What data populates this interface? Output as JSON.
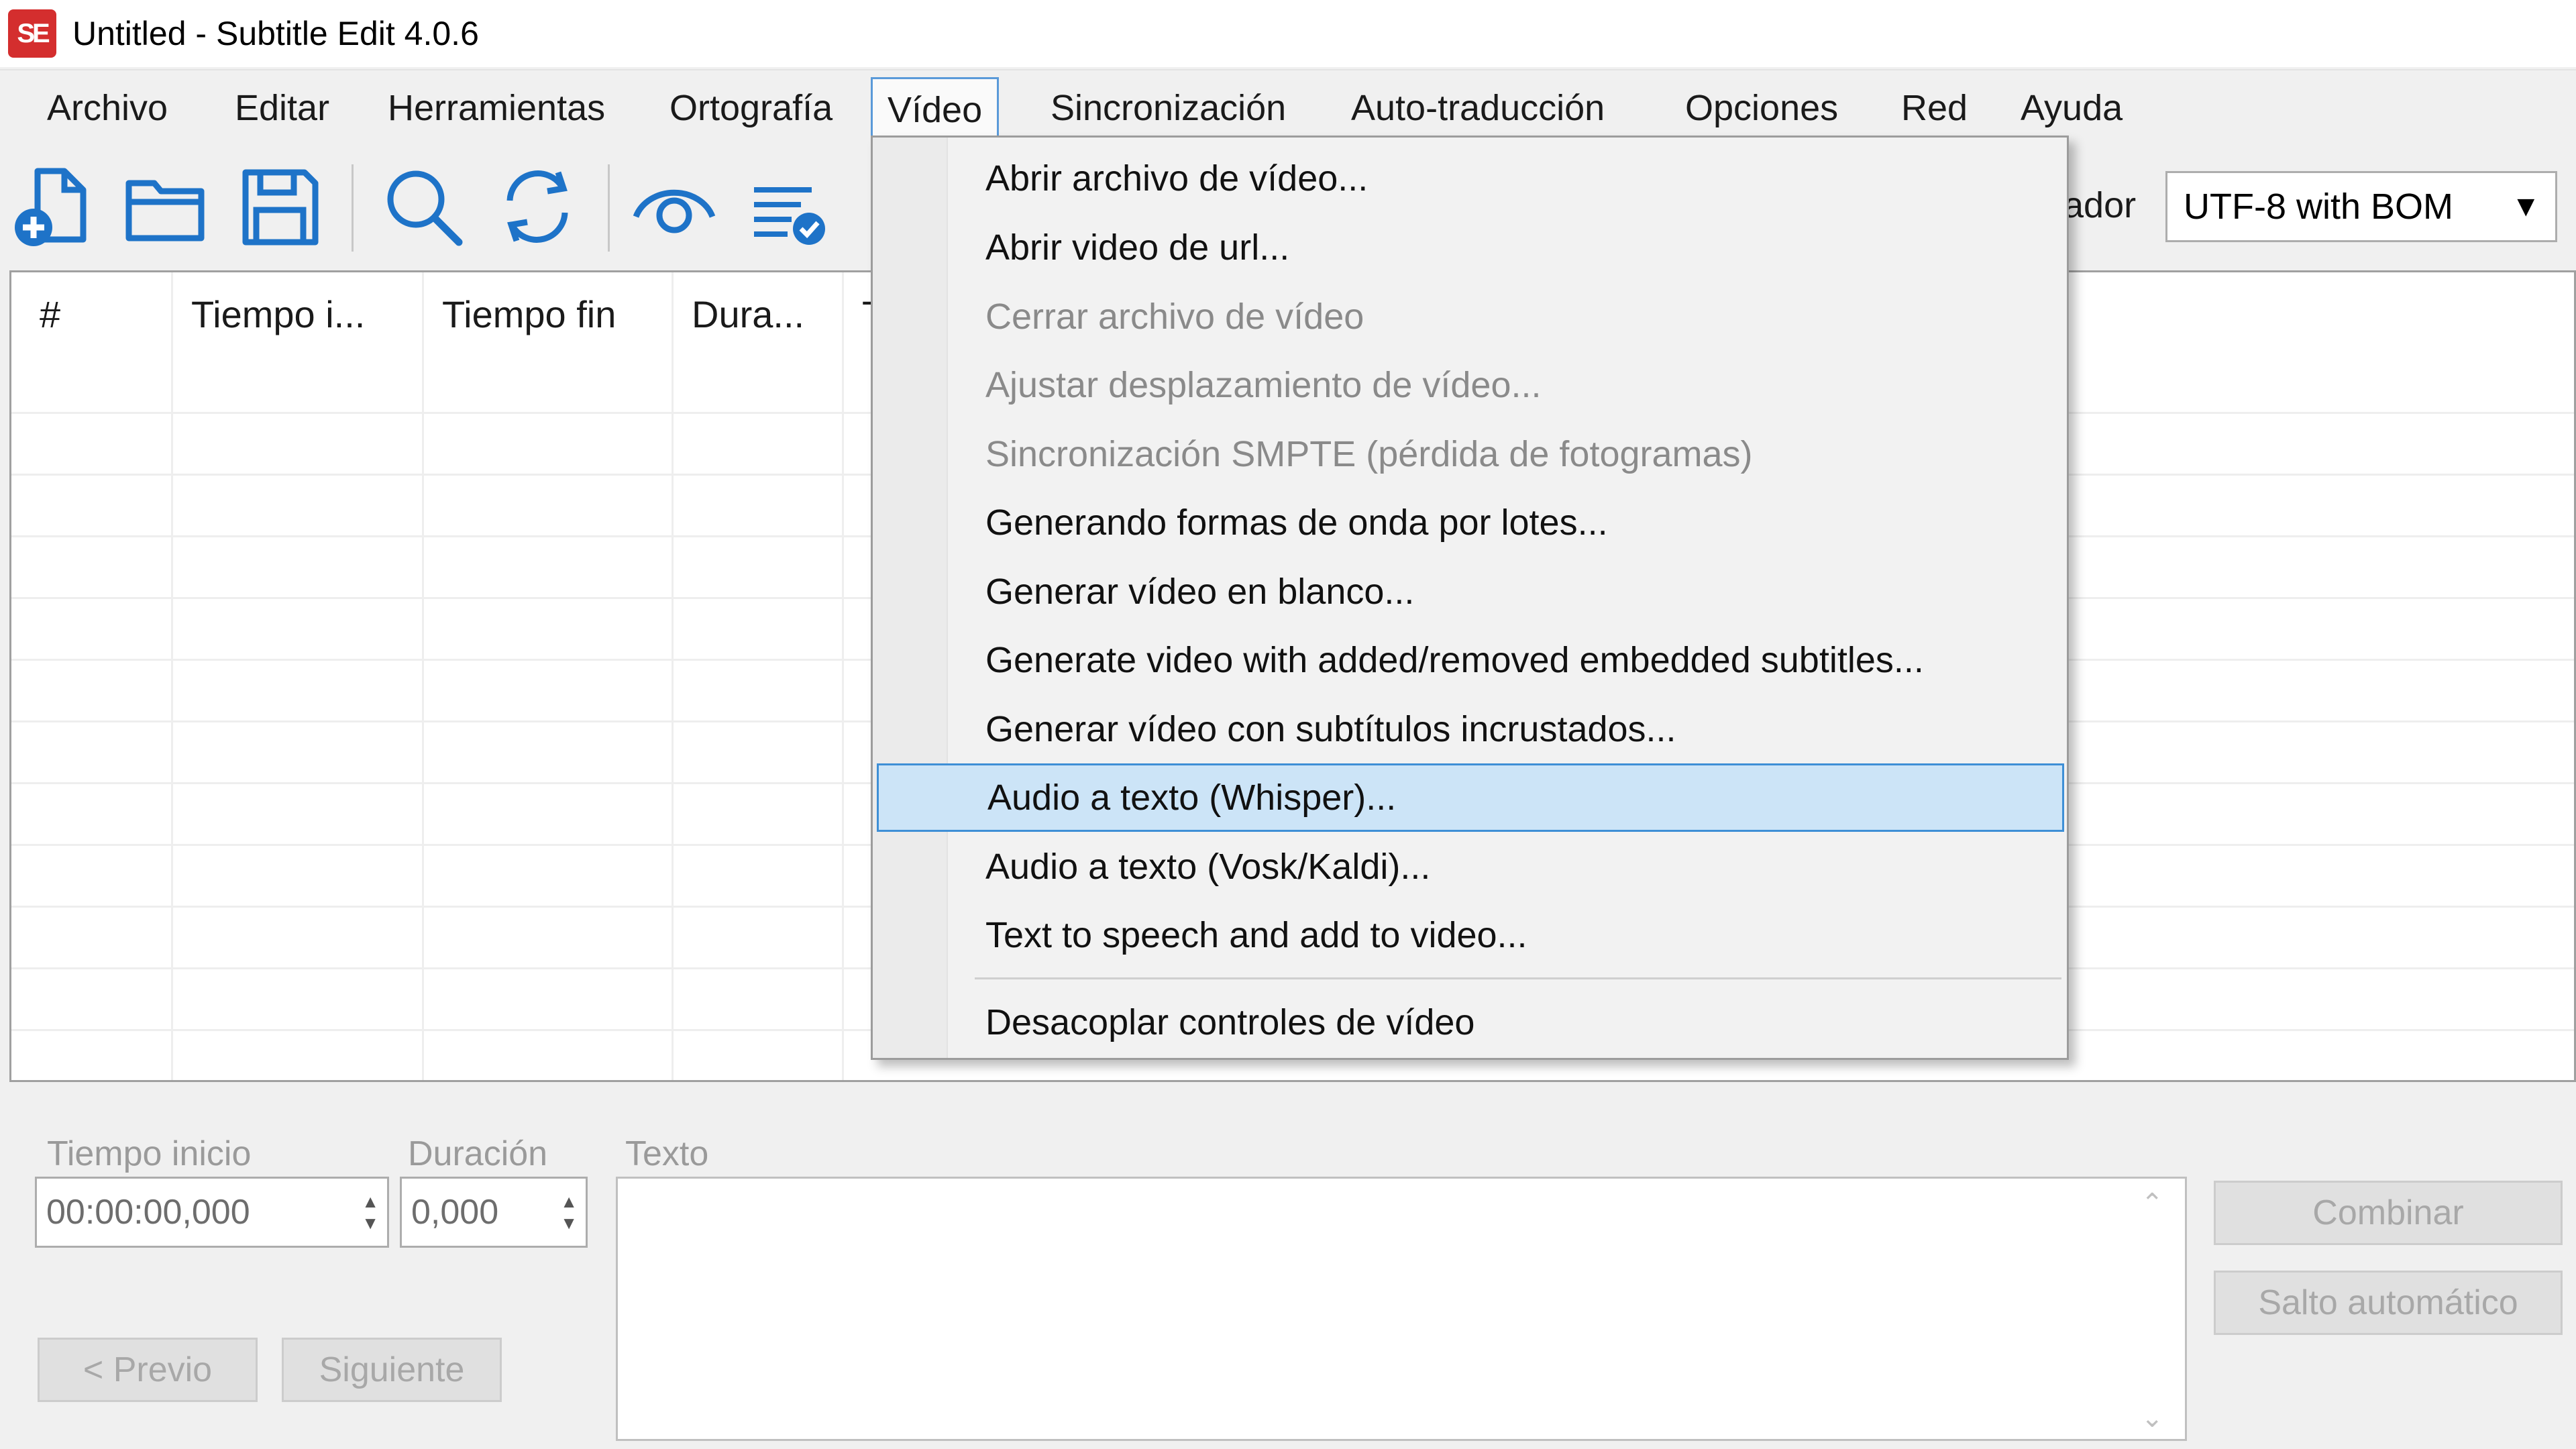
{
  "window": {
    "app_logo_text": "SE",
    "title": "Untitled - Subtitle Edit 4.0.6"
  },
  "menubar": {
    "items": [
      "Archivo",
      "Editar",
      "Herramientas",
      "Ortografía",
      "Vídeo",
      "Sincronización",
      "Auto-traducción",
      "Opciones",
      "Red",
      "Ayuda"
    ],
    "active": "Vídeo"
  },
  "toolbar": {
    "icons": [
      "new-file-icon",
      "open-folder-icon",
      "save-icon",
      "find-icon",
      "replace-icon",
      "visual-sync-icon",
      "spell-check-icon"
    ],
    "encoding_label_partial": "ador",
    "encoding_value": "UTF-8 with BOM"
  },
  "grid": {
    "columns": [
      "#",
      "Tiempo i...",
      "Tiempo fin",
      "Dura...",
      "T"
    ]
  },
  "editor": {
    "start_label": "Tiempo inicio",
    "start_value": "00:00:00,000",
    "duration_label": "Duración",
    "duration_value": "0,000",
    "text_label": "Texto",
    "prev_button": "< Previo",
    "next_button": "Siguiente",
    "combine_button": "Combinar",
    "auto_break_button": "Salto automático"
  },
  "video_menu": {
    "items": [
      {
        "label": "Abrir archivo de vídeo...",
        "enabled": true
      },
      {
        "label": "Abrir video de url...",
        "enabled": true
      },
      {
        "label": "Cerrar archivo de vídeo",
        "enabled": false
      },
      {
        "label": "Ajustar desplazamiento de vídeo...",
        "enabled": false
      },
      {
        "label": "Sincronización SMPTE (pérdida de fotogramas)",
        "enabled": false
      },
      {
        "label": "Generando formas de onda por lotes...",
        "enabled": true
      },
      {
        "label": "Generar vídeo en blanco...",
        "enabled": true
      },
      {
        "label": "Generate video with added/removed embedded subtitles...",
        "enabled": true
      },
      {
        "label": "Generar vídeo con subtítulos incrustados...",
        "enabled": true
      },
      {
        "label": "Audio a texto (Whisper)...",
        "enabled": true,
        "highlighted": true
      },
      {
        "label": "Audio a texto (Vosk/Kaldi)...",
        "enabled": true
      },
      {
        "label": "Text to speech and add to video...",
        "enabled": true
      },
      {
        "label": "Desacoplar controles de vídeo",
        "enabled": true
      }
    ]
  },
  "colors": {
    "accent_blue": "#1e73c8",
    "highlight_bg": "#cce4f7",
    "highlight_border": "#3e8fd6",
    "logo_red": "#d42e2e"
  }
}
